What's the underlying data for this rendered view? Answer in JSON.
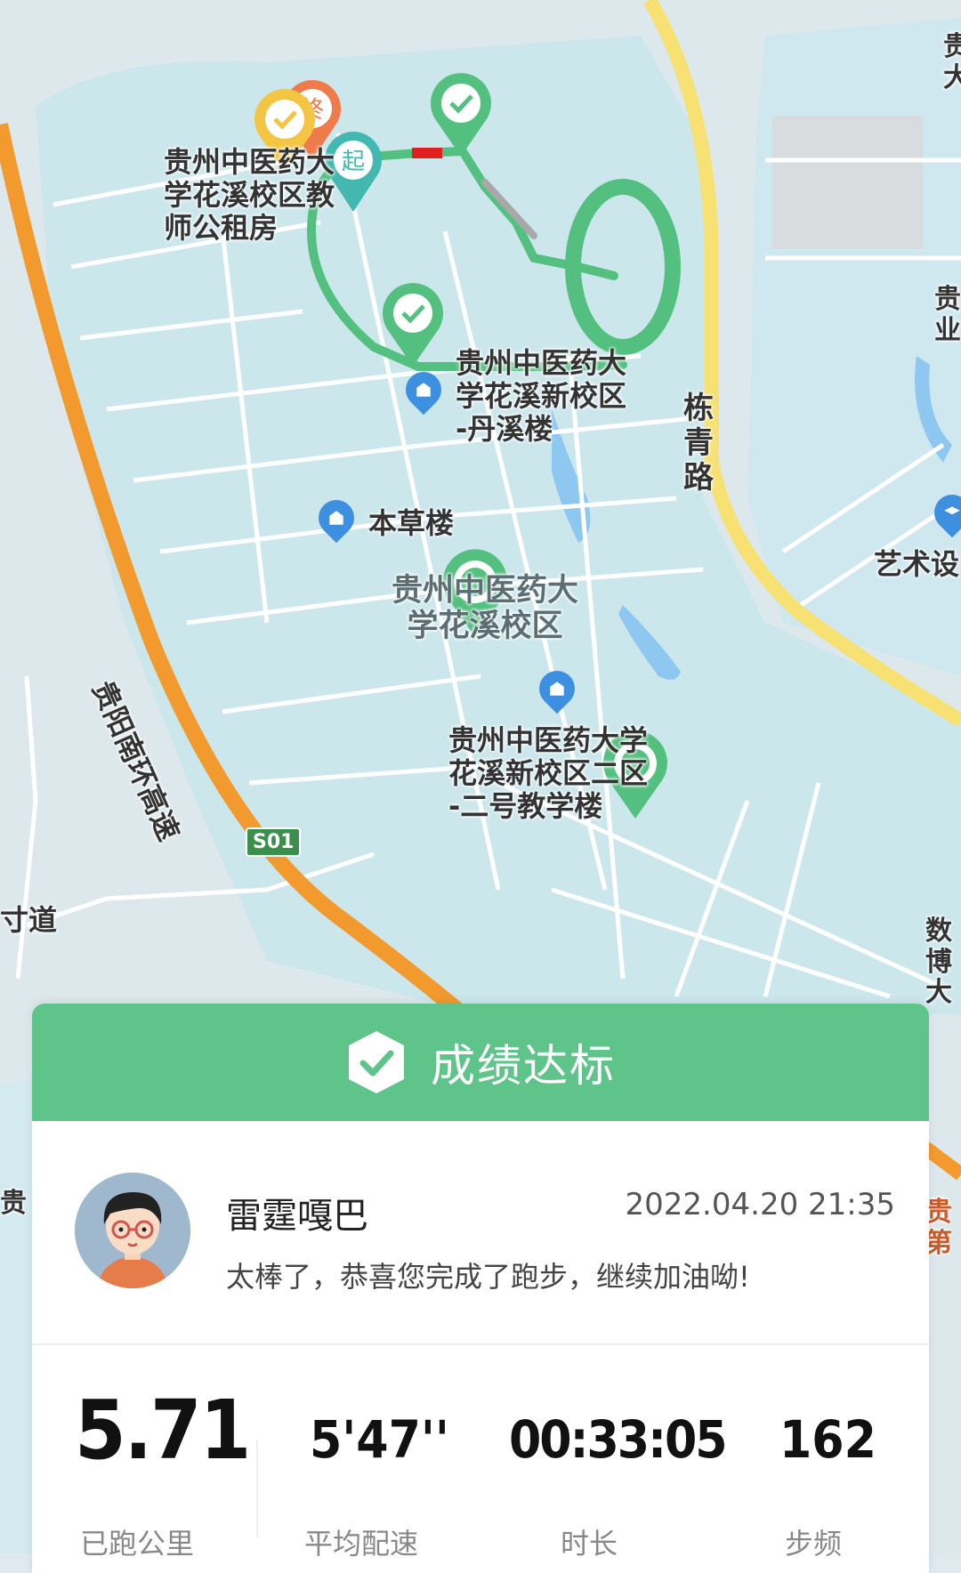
{
  "map": {
    "labels": {
      "teacher_housing": "贵州中医药大\n学花溪校区教\n师公租房",
      "danxi_building": "贵州中医药大\n学花溪新校区\n-丹溪楼",
      "bencao_building": "本草楼",
      "campus": "贵州中医药大\n学花溪校区",
      "teaching_building_2": "贵州中医药大学\n花溪新校区二区\n-二号教学楼",
      "lianqing_road": "栋\n青\n路",
      "ring_expressway": "贵阳南环高速",
      "highway_shield": "S01",
      "art_label": "艺术设",
      "left_road": "寸道",
      "right_edge_1": "贵\n大",
      "right_edge_2": "贵\n业",
      "right_edge_3": "数\n博\n大",
      "left_edge_4": "贵",
      "right_edge_5": "贵\n第",
      "start_marker": "起",
      "end_marker": "终"
    },
    "colors": {
      "route": "#54c07f",
      "route_gray": "#a8a8a8",
      "route_red": "#e02020",
      "expressway": "#f29a2e",
      "main_road": "#f6e172",
      "land": "#cbe7ec",
      "water": "#8ec8f0"
    }
  },
  "result": {
    "banner_text": "成绩达标",
    "username": "雷霆嘎巴",
    "datetime": "2022.04.20 21:35",
    "message": "太棒了，恭喜您完成了跑步，继续加油呦!",
    "stats": [
      {
        "value": "5.71",
        "label": "已跑公里"
      },
      {
        "value": "5'47''",
        "label": "平均配速"
      },
      {
        "value": "00:33:05",
        "label": "时长"
      },
      {
        "value": "162",
        "label": "步频"
      }
    ],
    "accent": "#5ec48a"
  }
}
